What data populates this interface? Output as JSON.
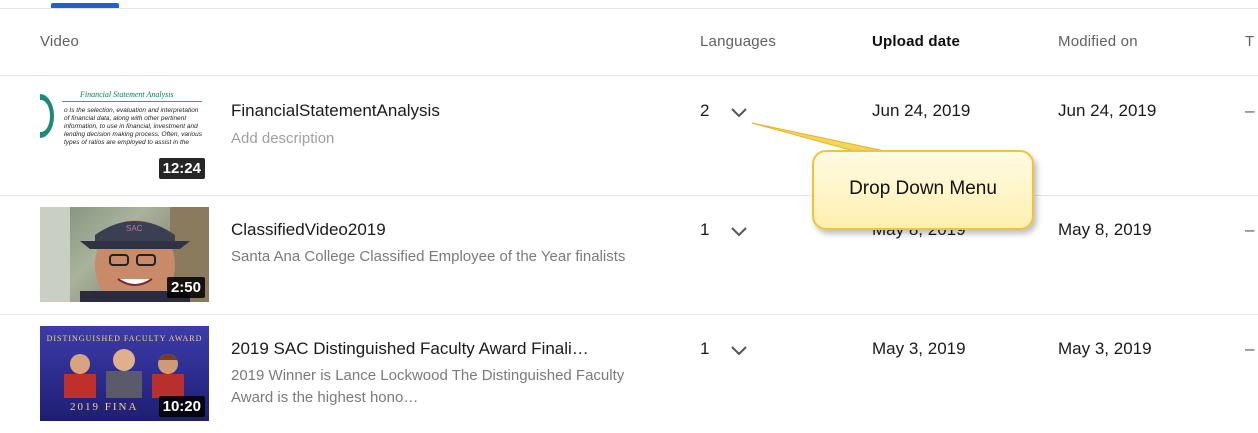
{
  "table": {
    "headers": {
      "video": "Video",
      "languages": "Languages",
      "upload_date": "Upload date",
      "modified_on": "Modified on",
      "truncated": "T"
    },
    "rows": [
      {
        "title": "FinancialStatementAnalysis",
        "description": "Add description",
        "duration": "12:24",
        "languages_count": "2",
        "upload_date": "Jun 24, 2019",
        "modified_on": "Jun 24, 2019",
        "trailing": "–",
        "thumb_title": "Financial Statement Analysis",
        "thumb_text": "o Is the selection, evaluation and interpretation of financial data, along with other pertinent information, to use in financial, investment and lending decision making process. Often, various types of ratios are employed to assist in the"
      },
      {
        "title": "ClassifiedVideo2019",
        "description": "Santa Ana College Classified Employee of the Year finalists",
        "duration": "2:50",
        "languages_count": "1",
        "upload_date": "May 8, 2019",
        "modified_on": "May 8, 2019",
        "trailing": "–"
      },
      {
        "title": "2019 SAC Distinguished Faculty Award Finali…",
        "description": "2019 Winner is Lance Lockwood The Distinguished Faculty Award is the highest hono…",
        "duration": "10:20",
        "languages_count": "1",
        "upload_date": "May 3, 2019",
        "modified_on": "May 3, 2019",
        "trailing": "–",
        "thumb_banner": "DISTINGUISHED FACULTY AWARD",
        "thumb_footer": "2019 FINA"
      }
    ]
  },
  "annotation": {
    "callout_text": "Drop Down Menu"
  },
  "colors": {
    "tab_indicator": "#1e62d0",
    "callout_border": "#f0c33a",
    "callout_fill": "#fff3bf"
  }
}
